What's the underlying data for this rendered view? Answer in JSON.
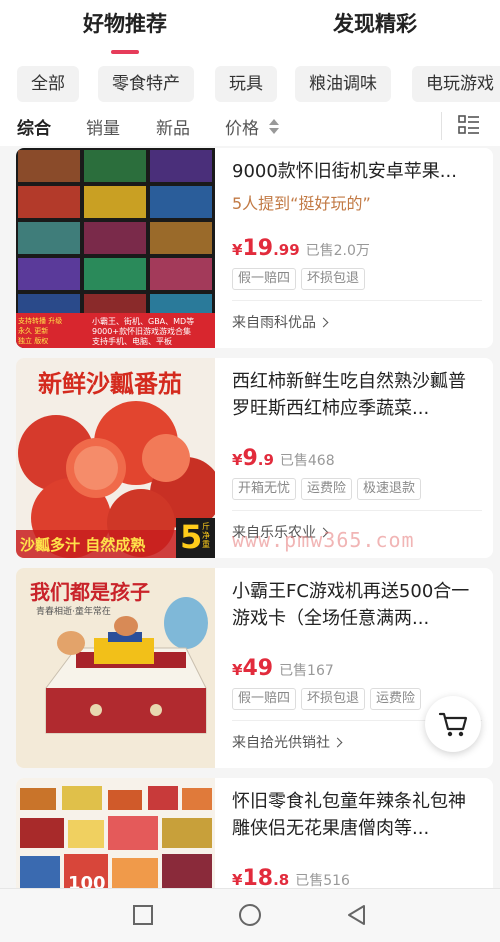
{
  "top_tabs": [
    {
      "label": "好物推荐",
      "active": true
    },
    {
      "label": "发现精彩",
      "active": false
    }
  ],
  "categories": [
    "全部",
    "零食特产",
    "玩具",
    "粮油调味",
    "电玩游戏"
  ],
  "selected_category": "全部",
  "sort_options": [
    "综合",
    "销量",
    "新品",
    "价格"
  ],
  "active_sort": "综合",
  "colors": {
    "accent": "#e63c5a",
    "price": "#e22b3c",
    "highlight_text": "#c27a45"
  },
  "products": [
    {
      "title": "9000款怀旧街机安卓苹果...",
      "subtitle": "5人提到“挺好玩的”",
      "price_currency": "¥",
      "price_int": "19",
      "price_dec": ".99",
      "sold": "已售2.0万",
      "tags": [
        "假一赔四",
        "坏损包退"
      ],
      "source": "来自雨科优品",
      "image_text": {
        "line1": "小霸王、街机、GBA、MD等",
        "line2": "9000+款怀旧游戏游戏合集",
        "line3": "支持手机、电脑、平板",
        "left1": "支持转播 升级",
        "left2": "永久 更新",
        "left3": "独立 版权"
      }
    },
    {
      "title": "西红柿新鲜生吃自然熟沙瓤普罗旺斯西红柿应季蔬菜...",
      "price_currency": "¥",
      "price_int": "9",
      "price_dec": ".9",
      "sold": "已售468",
      "tags": [
        "开箱无忧",
        "运费险",
        "极速退款"
      ],
      "source": "来自乐乐农业",
      "image_text": {
        "headline": "新鲜沙瓤番茄",
        "footer": "沙瓤多汁 自然成熟",
        "badge_num": "5",
        "badge_unit": "斤净重"
      }
    },
    {
      "title": "小霸王FC游戏机再送500合一游戏卡（全场任意满两...",
      "price_currency": "¥",
      "price_int": "49",
      "price_dec": "",
      "sold": "已售167",
      "tags": [
        "假一赔四",
        "坏损包退",
        "运费险"
      ],
      "source": "来自拾光供销社",
      "image_text": {
        "headline": "我们都是孩子",
        "tagline": "青春相逝·童年常在"
      }
    },
    {
      "title": "怀旧零食礼包童年辣条礼包神雕侠侣无花果唐僧肉等...",
      "price_currency": "¥",
      "price_int": "18",
      "price_dec": ".8",
      "sold": "已售516",
      "tags": [],
      "source": "",
      "image_text": {
        "footer": "100"
      }
    }
  ],
  "watermark": "www.pmw365.com",
  "icons": {
    "layout_toggle": "list-view-icon",
    "cart": "shopping-cart-icon",
    "nav_recent": "square-icon",
    "nav_home": "circle-icon",
    "nav_back": "triangle-back-icon"
  }
}
